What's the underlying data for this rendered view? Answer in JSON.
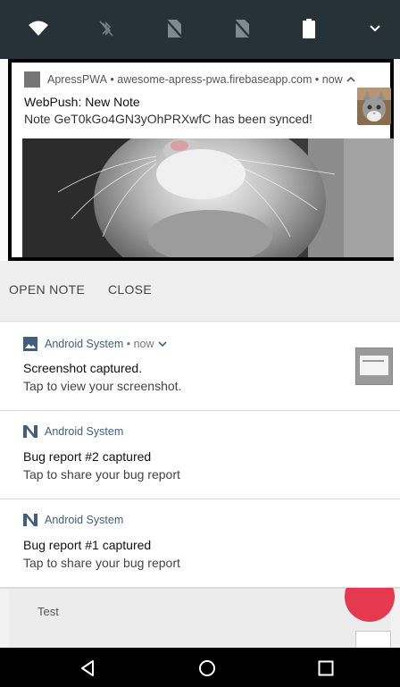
{
  "status_icons": [
    "wifi-icon",
    "bluetooth-off-icon",
    "no-sim-icon",
    "no-sim-icon",
    "battery-icon",
    "expand-icon"
  ],
  "highlighted_notification": {
    "app_name": "ApressPWA",
    "origin": "awesome-apress-pwa.firebaseapp.com",
    "time": "now",
    "title": "WebPush: New Note",
    "body": "Note GeT0kGo4GN3yOhPRXwfC has been synced!",
    "actions": [
      "OPEN NOTE",
      "CLOSE"
    ]
  },
  "notifications": [
    {
      "app": "Android System",
      "time": "now",
      "title": "Screenshot captured.",
      "text": "Tap to view your screenshot."
    },
    {
      "app": "Android System",
      "title": "Bug report #2 captured",
      "text": "Tap to share your bug report"
    },
    {
      "app": "Android System",
      "title": "Bug report #1 captured",
      "text": "Tap to share your bug report"
    }
  ],
  "background_app": {
    "text": "Test",
    "accent_color": "#e53950"
  },
  "nav": [
    "back-icon",
    "home-icon",
    "recents-icon"
  ]
}
